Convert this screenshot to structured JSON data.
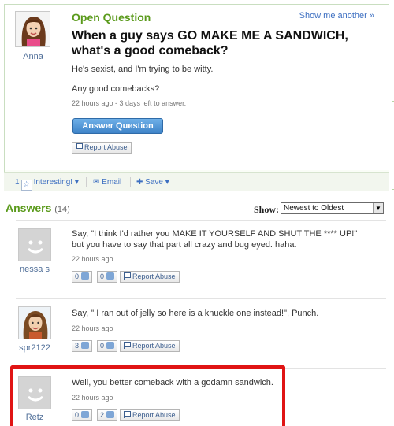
{
  "question": {
    "status": "Open Question",
    "show_another": "Show me another »",
    "asker_name": "Anna",
    "title": "When a guy says GO MAKE ME A SANDWICH, what's a good comeback?",
    "body": "He's sexist, and I'm trying to be witty.",
    "additional": "Any good comebacks?",
    "time": "22 hours ago - 3 days left to answer.",
    "answer_button": "Answer Question",
    "report_abuse": "Report Abuse"
  },
  "toolbar": {
    "interesting_count": "1",
    "interesting_label": "Interesting!",
    "email_label": "Email",
    "save_label": "Save"
  },
  "answers_header": {
    "title": "Answers",
    "count": "(14)",
    "show_label": "Show:",
    "sort_selected": "Newest to Oldest"
  },
  "answers": [
    {
      "user": "nessa s",
      "text": "Say, \"I think I'd rather you MAKE IT YOURSELF AND SHUT THE **** UP!\" but you have to say that part all crazy and bug eyed. haha.",
      "time": "22 hours ago",
      "thumbs_up": "0",
      "thumbs_down": "0",
      "report": "Report Abuse"
    },
    {
      "user": "spr2122",
      "text": "Say, \" I ran out of jelly so here is a knuckle one instead!\", Punch.",
      "time": "22 hours ago",
      "thumbs_up": "3",
      "thumbs_down": "0",
      "report": "Report Abuse"
    },
    {
      "user": "Retz",
      "text": "Well, you better comeback with a godamn sandwich.",
      "time": "22 hours ago",
      "thumbs_up": "0",
      "thumbs_down": "2",
      "report": "Report Abuse"
    }
  ],
  "colors": {
    "accent_green": "#5a9a1b",
    "link_blue": "#3d6fc1",
    "highlight_red": "#e01414"
  }
}
